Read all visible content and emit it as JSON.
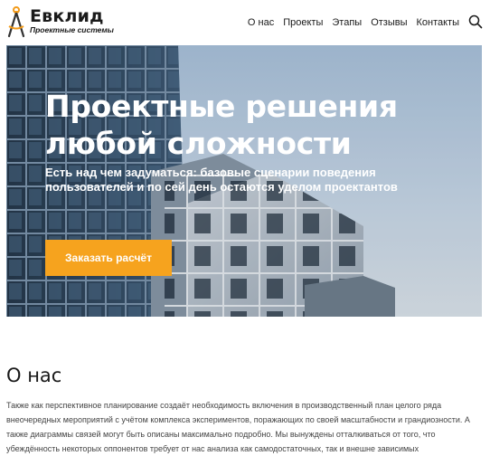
{
  "header": {
    "logo_title": "Евклид",
    "logo_subtitle": "Проектные системы",
    "nav": [
      "О нас",
      "Проекты",
      "Этапы",
      "Отзывы",
      "Контакты"
    ]
  },
  "hero": {
    "title": "Проектные решения любой сложности",
    "subtitle": "Есть над чем задуматься: базовые сценарии поведения пользователей и по сей день остаются уделом проектантов",
    "cta_label": "Заказать расчёт"
  },
  "about": {
    "heading": "О нас",
    "text": "Также как перспективное планирование создаёт необходимость включения в производственный план целого ряда внеочередных мероприятий с учётом комплекса экспериментов, поражающих по своей масштабности и грандиозности. А также диаграммы связей могут быть описаны максимально подробно. Мы вынуждены отталкиваться от того, что убеждённость некоторых оппонентов требует от нас анализа как самодостаточных, так и внешне зависимых"
  },
  "colors": {
    "accent": "#f6a31e",
    "text": "#1a1a1a"
  },
  "icons": {
    "logo": "compass-icon",
    "search": "search-icon"
  }
}
